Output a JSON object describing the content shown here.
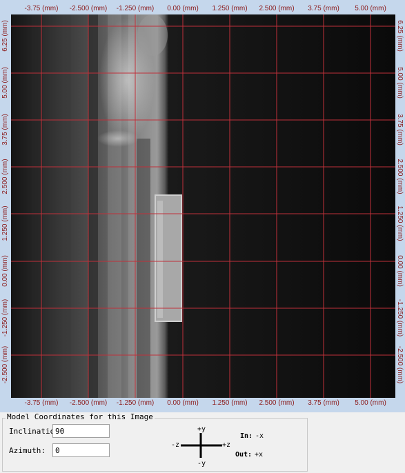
{
  "viewer": {
    "x_ticks": [
      "-3.75 (mm)",
      "-2.500 (mm)",
      "-1.250 (mm)",
      "0.00 (mm)",
      "1.250 (mm)",
      "2.500 (mm)",
      "3.75 (mm)",
      "5.00 (mm)"
    ],
    "y_ticks": [
      "6.25 (mm)",
      "5.00 (mm)",
      "3.75 (mm)",
      "2.500 (mm)",
      "1.250 (mm)",
      "0.00 (mm)",
      "-1.250 (mm)",
      "-2.500 (mm)"
    ],
    "grid_color": "#c0303a",
    "tick_color": "#8b1a1a"
  },
  "model_coordinates": {
    "title": "Model Coordinates for this Image",
    "inclination_label": "Inclination:",
    "inclination_value": "90",
    "azimuth_label": "Azimuth:",
    "azimuth_value": "0"
  },
  "orientation": {
    "plus_y": "+y",
    "minus_y": "-y",
    "minus_z": "-z",
    "plus_z": "+z",
    "in_label": "In:",
    "in_value": "-x",
    "out_label": "Out:",
    "out_value": "+x"
  }
}
